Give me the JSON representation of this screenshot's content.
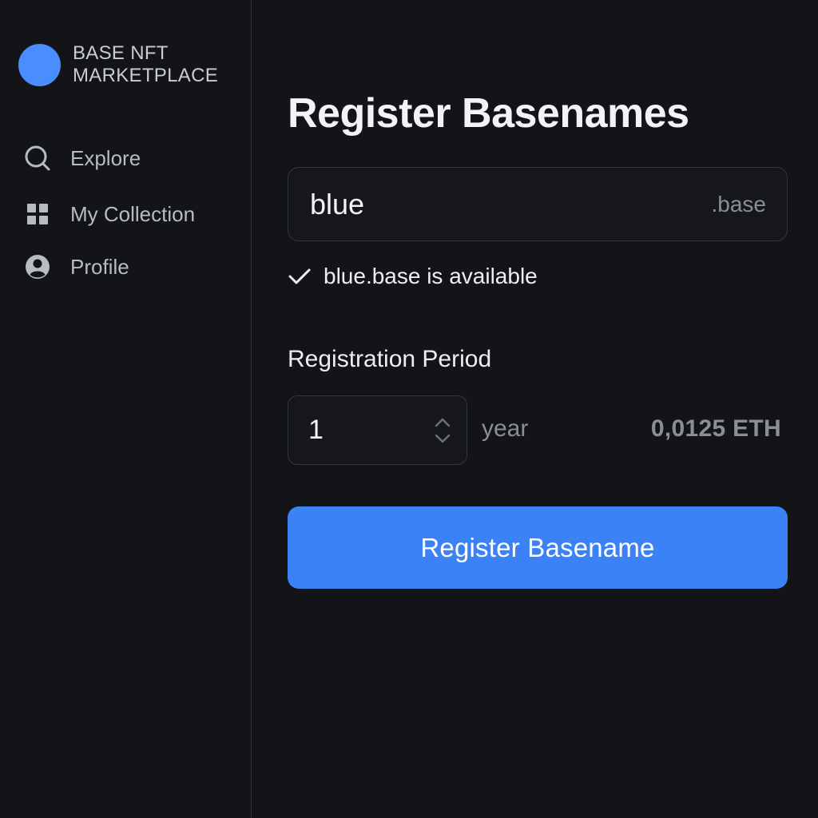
{
  "brand": {
    "name": "BASE NFT MARKETPLACE",
    "logo_color": "#4a8dff"
  },
  "sidebar": {
    "items": [
      {
        "label": "Explore",
        "icon": "search-icon"
      },
      {
        "label": "My Collection",
        "icon": "grid-icon"
      },
      {
        "label": "Profile",
        "icon": "user-circle-icon"
      }
    ]
  },
  "main": {
    "title": "Register Basenames",
    "name_field": {
      "value": "blue",
      "suffix": ".base"
    },
    "availability": {
      "text": "blue.base is available",
      "icon": "check-icon"
    },
    "period": {
      "label": "Registration Period",
      "value": "1",
      "unit": "year",
      "price": "0,0125 ETH"
    },
    "register_button": {
      "label": "Register Basename",
      "color": "#3b82f6"
    }
  },
  "colors": {
    "background": "#121418",
    "accent": "#3b82f6",
    "muted_text": "#8a8f97"
  }
}
